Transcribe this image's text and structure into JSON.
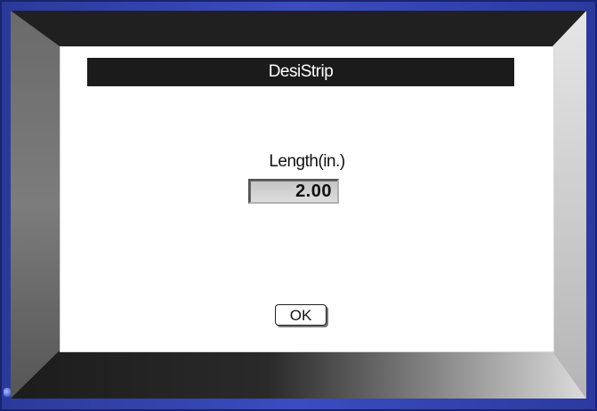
{
  "dialog": {
    "title": "DesiStrip",
    "field_label": "Length(in.)",
    "field_value": "2.00",
    "ok_label": "OK"
  },
  "colors": {
    "bezel": "#3a4cc0",
    "titlebar": "#1b1b1b",
    "dialog_bg": "#ffffff",
    "screen_bg": "#2b2b2b"
  }
}
